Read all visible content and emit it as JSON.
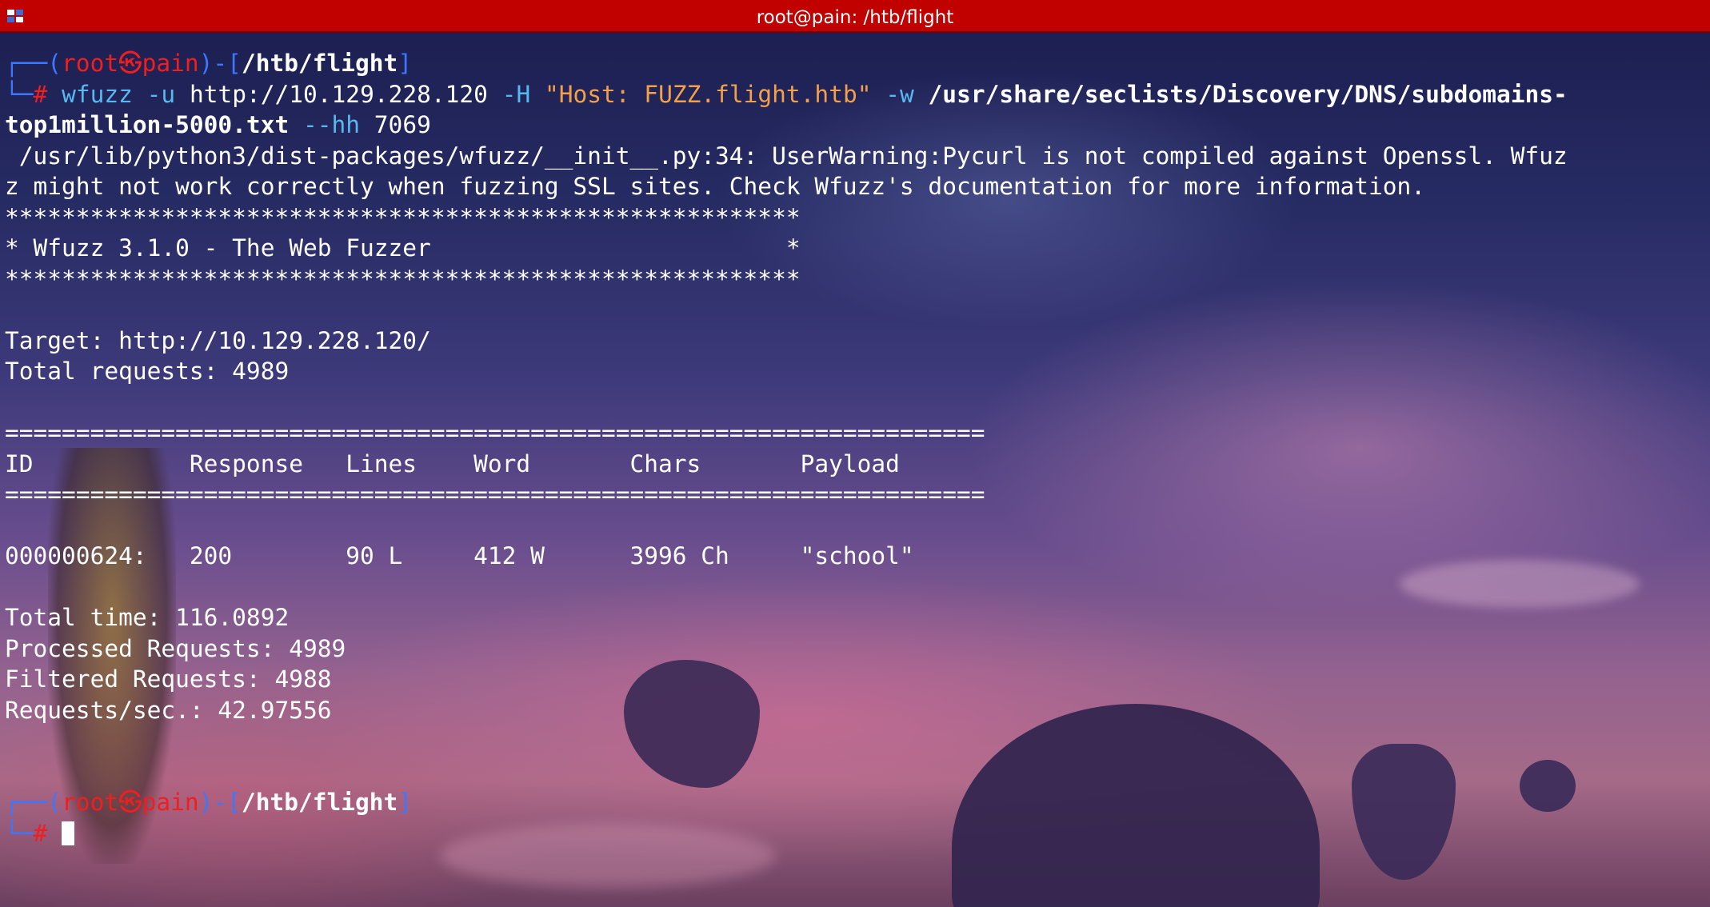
{
  "window": {
    "title": "root@pain: /htb/flight",
    "app_icon": "terminal-app-icon"
  },
  "prompt1": {
    "user": "root",
    "sep": "㉿",
    "host": "pain",
    "path": "/htb/flight"
  },
  "command": {
    "prompt_char": "#",
    "bin": "wfuzz",
    "flag_u": "-u",
    "url": "http://10.129.228.120",
    "flag_h": "-H",
    "header": "\"Host: FUZZ.flight.htb\"",
    "flag_w": "-w",
    "wordlist_a": "/usr/share/seclists/Discovery/DNS/subdomains-",
    "wordlist_b": "top1million-5000.txt",
    "flag_hh": "--hh",
    "hh_value": "7069"
  },
  "output": {
    "warning_1": " /usr/lib/python3/dist-packages/wfuzz/__init__.py:34: UserWarning:Pycurl is not compiled against Openssl. Wfuz",
    "warning_2": "z might not work correctly when fuzzing SSL sites. Check Wfuzz's documentation for more information.",
    "banner_border": "********************************************************",
    "banner_text": "* Wfuzz 3.1.0 - The Web Fuzzer                         *",
    "target": "Target: http://10.129.228.120/",
    "total_requests": "Total requests: 4989",
    "divider": "=====================================================================",
    "header_row": "ID           Response   Lines    Word       Chars       Payload",
    "result_row": "000000624:   200        90 L     412 W      3996 Ch     \"school\"",
    "total_time": "Total time: 116.0892",
    "processed": "Processed Requests: 4989",
    "filtered": "Filtered Requests: 4988",
    "rate": "Requests/sec.: 42.97556"
  },
  "prompt2": {
    "user": "root",
    "sep": "㉿",
    "host": "pain",
    "path": "/htb/flight",
    "prompt_char": "#"
  },
  "colors": {
    "titlebar": "#c10000",
    "prompt_frame": "#3c78ff",
    "prompt_user": "#f01e1e",
    "command": "#58b8f0",
    "string": "#f2a14a"
  }
}
